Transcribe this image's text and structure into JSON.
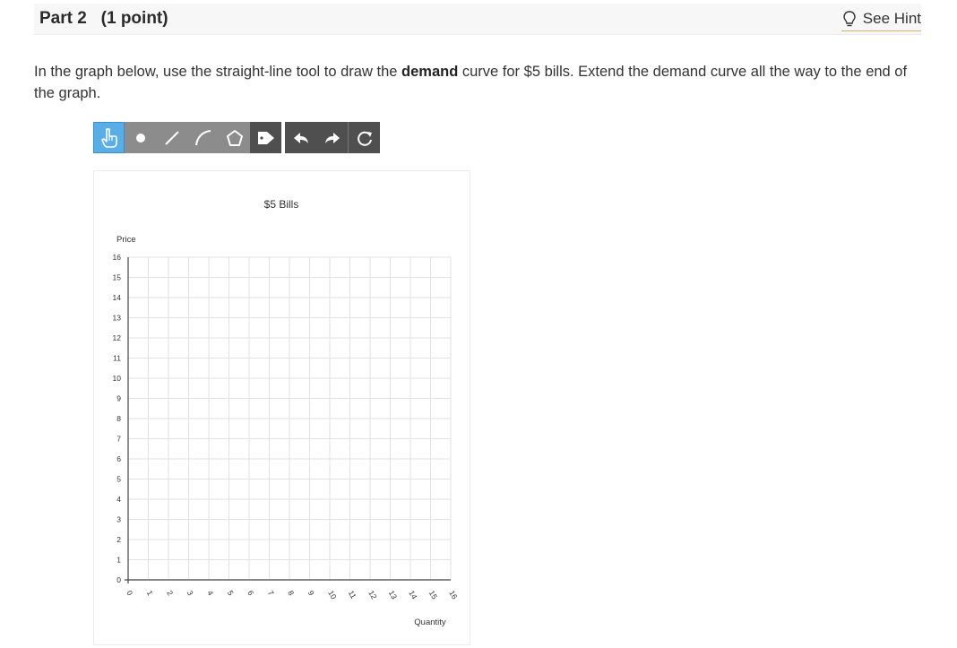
{
  "header": {
    "part_label": "Part 2",
    "points_label": "(1 point)",
    "hint_label": "See Hint"
  },
  "prompt": {
    "before": "In the graph below, use the straight-line tool to draw the ",
    "bold": "demand",
    "after": " curve for $5 bills. Extend the demand curve all the way to the end of the graph."
  },
  "toolbar": {
    "tools": [
      {
        "name": "pointer-tool",
        "icon": "hand-pointer-icon",
        "state": "selected",
        "color": "#5aaee8"
      },
      {
        "name": "point-tool",
        "icon": "dot-icon"
      },
      {
        "name": "straight-line-tool",
        "icon": "line-icon"
      },
      {
        "name": "curve-tool",
        "icon": "curve-icon"
      },
      {
        "name": "polygon-tool",
        "icon": "pentagon-icon"
      },
      {
        "name": "label-tool",
        "icon": "tag-icon"
      },
      {
        "name": "undo-button",
        "icon": "undo-arrow-icon"
      },
      {
        "name": "redo-button",
        "icon": "redo-arrow-icon"
      },
      {
        "name": "reset-button",
        "icon": "refresh-icon"
      }
    ]
  },
  "graph": {
    "title": "$5 Bills",
    "y_axis_label": "Price",
    "x_axis_label": "Quantity"
  },
  "chart_data": {
    "type": "scatter",
    "title": "$5 Bills",
    "xlabel": "Quantity",
    "ylabel": "Price",
    "xlim": [
      0,
      16
    ],
    "ylim": [
      0,
      16
    ],
    "x_ticks": [
      0,
      1,
      2,
      3,
      4,
      5,
      6,
      7,
      8,
      9,
      10,
      11,
      12,
      13,
      14,
      15,
      16
    ],
    "y_ticks": [
      0,
      1,
      2,
      3,
      4,
      5,
      6,
      7,
      8,
      9,
      10,
      11,
      12,
      13,
      14,
      15,
      16
    ],
    "grid": true,
    "series": []
  }
}
